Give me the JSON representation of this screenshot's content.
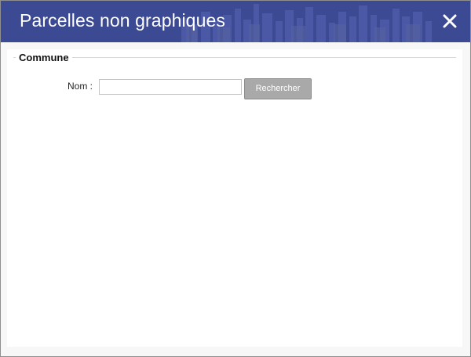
{
  "dialog": {
    "title": "Parcelles non graphiques",
    "close_icon": "close-icon",
    "header_color": "#3c4a94"
  },
  "form": {
    "section_legend": "Commune",
    "nom_label": "Nom :",
    "nom_value": "",
    "search_label": "Rechercher",
    "button_color": "#a9a9a9"
  }
}
